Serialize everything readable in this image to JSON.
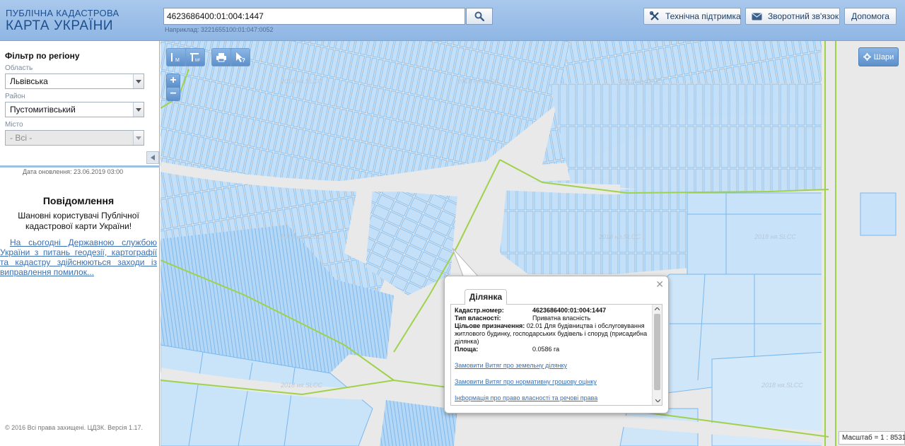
{
  "header": {
    "logo_line1": "ПУБЛІЧНА КАДАСТРОВА",
    "logo_line2": "КАРТА УКРАЇНИ",
    "search_value": "4623686400:01:004:1447",
    "search_hint": "Наприклад: 3221655100:01:047:0052",
    "buttons": {
      "support": "Технічна підтримка",
      "feedback": "Зворотний зв'язок",
      "help": "Допомога"
    }
  },
  "sidebar": {
    "filter_title": "Фільтр по регіону",
    "oblast_label": "Область",
    "oblast_value": "Львівська",
    "rayon_label": "Район",
    "rayon_value": "Пустомитівський",
    "misto_label": "Місто",
    "misto_value": "- Всі -",
    "update_date": "Дата оновлення: 23.06.2019 03:00",
    "notice_title": "Повідомлення",
    "notice_text": "Шановні користувачі Публічної кадастрової карти України!",
    "notice_link": "На сьогодні Державною службою України з питань геодезії, картографії та кадастру здійснюються заходи із виправлення помилок...",
    "copyright": "© 2016 Всі права захищені. ЦДЗК. Версія 1.17."
  },
  "map": {
    "layers_label": "Шари",
    "scale": "Масштаб = 1 : 8531",
    "watermark": "2018 ня.SLCC"
  },
  "popup": {
    "tab": "Ділянка",
    "fields": {
      "cadastr_label": "Кадастр.номер:",
      "cadastr_value": "4623686400:01:004:1447",
      "ownership_label": "Тип власності:",
      "ownership_value": "Приватна власність",
      "purpose_label": "Цільове призначення:",
      "purpose_value": "02.01 Для будівництва і обслуговування житлового будинку, господарських будівель і споруд (присадибна ділянка)",
      "area_label": "Площа:",
      "area_value": "0.0586 га"
    },
    "links": {
      "extract_land": "Замовити Витяг про земельну ділянку",
      "extract_valuation": "Замовити Витяг про нормативну грошову оцінку",
      "rights_info": "Інформація про право власності та речові права"
    }
  },
  "colors": {
    "header_bg": "#9fc1ea",
    "parcel_fill": "#bcdcf7",
    "parcel_stroke": "#6fb1ea",
    "boundary_green": "#9ed24a",
    "link_blue": "#3a6fb4"
  }
}
